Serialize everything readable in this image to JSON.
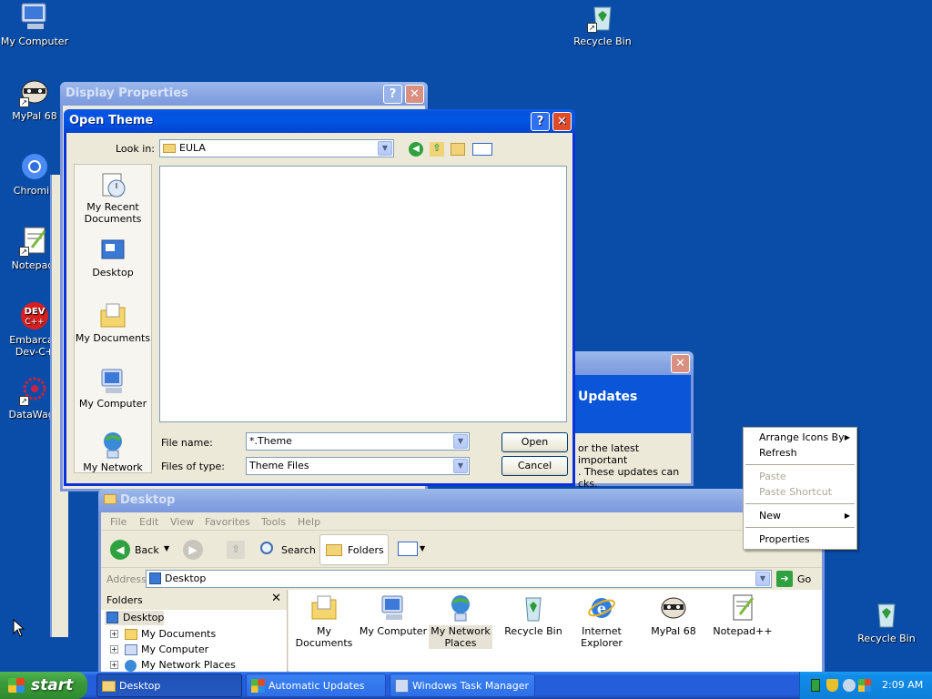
{
  "desktop": {
    "icons_left": [
      {
        "label": "My Computer",
        "icon": "computer-icon"
      },
      {
        "label": "MyPal 68",
        "icon": "raccoon-browser-icon"
      },
      {
        "label": "Chromiu",
        "icon": "chromium-icon"
      },
      {
        "label": "Notepad-",
        "icon": "notepad-icon"
      },
      {
        "label": "Embarcad",
        "label2": "Dev-C+",
        "icon": "devcpp-icon"
      },
      {
        "label": "DataWago",
        "icon": "datawagon-icon"
      }
    ],
    "recycle_top": "Recycle Bin",
    "recycle_right": "Recycle Bin"
  },
  "display_properties": {
    "title": "Display Properties"
  },
  "open_theme": {
    "title": "Open Theme",
    "look_in_label": "Look in:",
    "look_in_value": "EULA",
    "places": [
      "My Recent Documents",
      "Desktop",
      "My Documents",
      "My Computer",
      "My Network"
    ],
    "file_name_label": "File name:",
    "file_name_value": "*.Theme",
    "file_type_label": "Files of type:",
    "file_type_value": "Theme Files",
    "open_label": "Open",
    "cancel_label": "Cancel"
  },
  "updates_window": {
    "heading": "Updates",
    "text_lines": [
      "or the latest important",
      ". These updates can",
      "cks."
    ]
  },
  "explorer": {
    "title": "Desktop",
    "menu": [
      "File",
      "Edit",
      "View",
      "Favorites",
      "Tools",
      "Help"
    ],
    "back_label": "Back",
    "search_label": "Search",
    "folders_label": "Folders",
    "address_label": "Address",
    "address_value": "Desktop",
    "go_label": "Go",
    "folders_panel_title": "Folders",
    "tree": [
      "Desktop",
      "My Documents",
      "My Computer",
      "My Network Places"
    ],
    "items": [
      {
        "label": "My Documents",
        "icon": "my-documents-icon"
      },
      {
        "label": "My Computer",
        "icon": "my-computer-icon"
      },
      {
        "label": "My Network Places",
        "icon": "network-places-icon"
      },
      {
        "label": "Recycle Bin",
        "icon": "recycle-bin-icon"
      },
      {
        "label": "Internet Explorer",
        "icon": "internet-explorer-icon"
      },
      {
        "label": "MyPal 68",
        "icon": "mypal-icon"
      },
      {
        "label": "Notepad++",
        "icon": "notepadpp-icon"
      }
    ]
  },
  "context_menu": {
    "items": [
      "Arrange Icons By",
      "Refresh",
      "Paste",
      "Paste Shortcut",
      "New",
      "Properties"
    ]
  },
  "taskbar": {
    "start_label": "start",
    "tasks": [
      "Desktop",
      "Automatic Updates",
      "Windows Task Manager"
    ],
    "clock": "2:09 AM"
  },
  "colors": {
    "desktop": "#0a4da8",
    "titlebar": "#0054e3",
    "taskbar": "#245edb",
    "tray": "#0f8dea"
  }
}
